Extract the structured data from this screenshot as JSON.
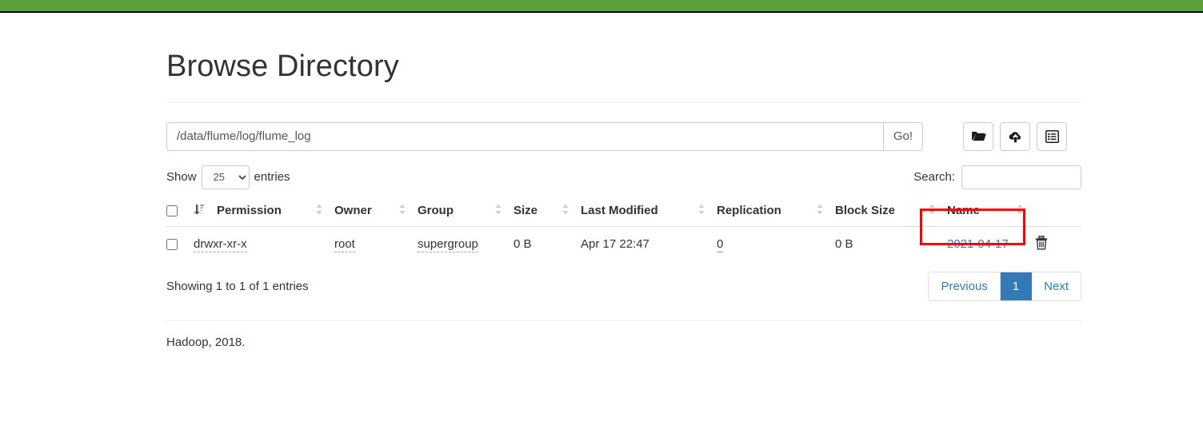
{
  "topbar": {
    "color": "#5ba03b"
  },
  "page": {
    "title": "Browse Directory"
  },
  "pathbar": {
    "value": "/data/flume/log/flume_log",
    "placeholder": "Enter a directory path",
    "go_label": "Go!",
    "buttons": [
      {
        "icon": "folder-open-icon",
        "name": "create-directory-button"
      },
      {
        "icon": "cloud-upload-icon",
        "name": "upload-files-button"
      },
      {
        "icon": "list-alt-icon",
        "name": "snapshot-button"
      }
    ]
  },
  "controls": {
    "show_label": "Show",
    "entries_label": "entries",
    "page_length": "25",
    "page_length_options": [
      "25",
      "50",
      "100"
    ],
    "search_label": "Search:",
    "search_value": "",
    "search_placeholder": ""
  },
  "table": {
    "columns": [
      "Permission",
      "Owner",
      "Group",
      "Size",
      "Last Modified",
      "Replication",
      "Block Size",
      "Name"
    ],
    "rows": [
      {
        "permission": "drwxr-xr-x",
        "owner": "root",
        "group": "supergroup",
        "size": "0 B",
        "last_modified": "Apr 17 22:47",
        "replication": "0",
        "block_size": "0 B",
        "name": "2021-04-17"
      }
    ]
  },
  "pagination": {
    "info": "Showing 1 to 1 of 1 entries",
    "previous_label": "Previous",
    "page_label": "1",
    "next_label": "Next",
    "active_color": "#337ab7"
  },
  "footer": {
    "text": "Hadoop, 2018."
  },
  "annotation": {
    "highlight_color": "#ff0000",
    "target": "name-link"
  }
}
